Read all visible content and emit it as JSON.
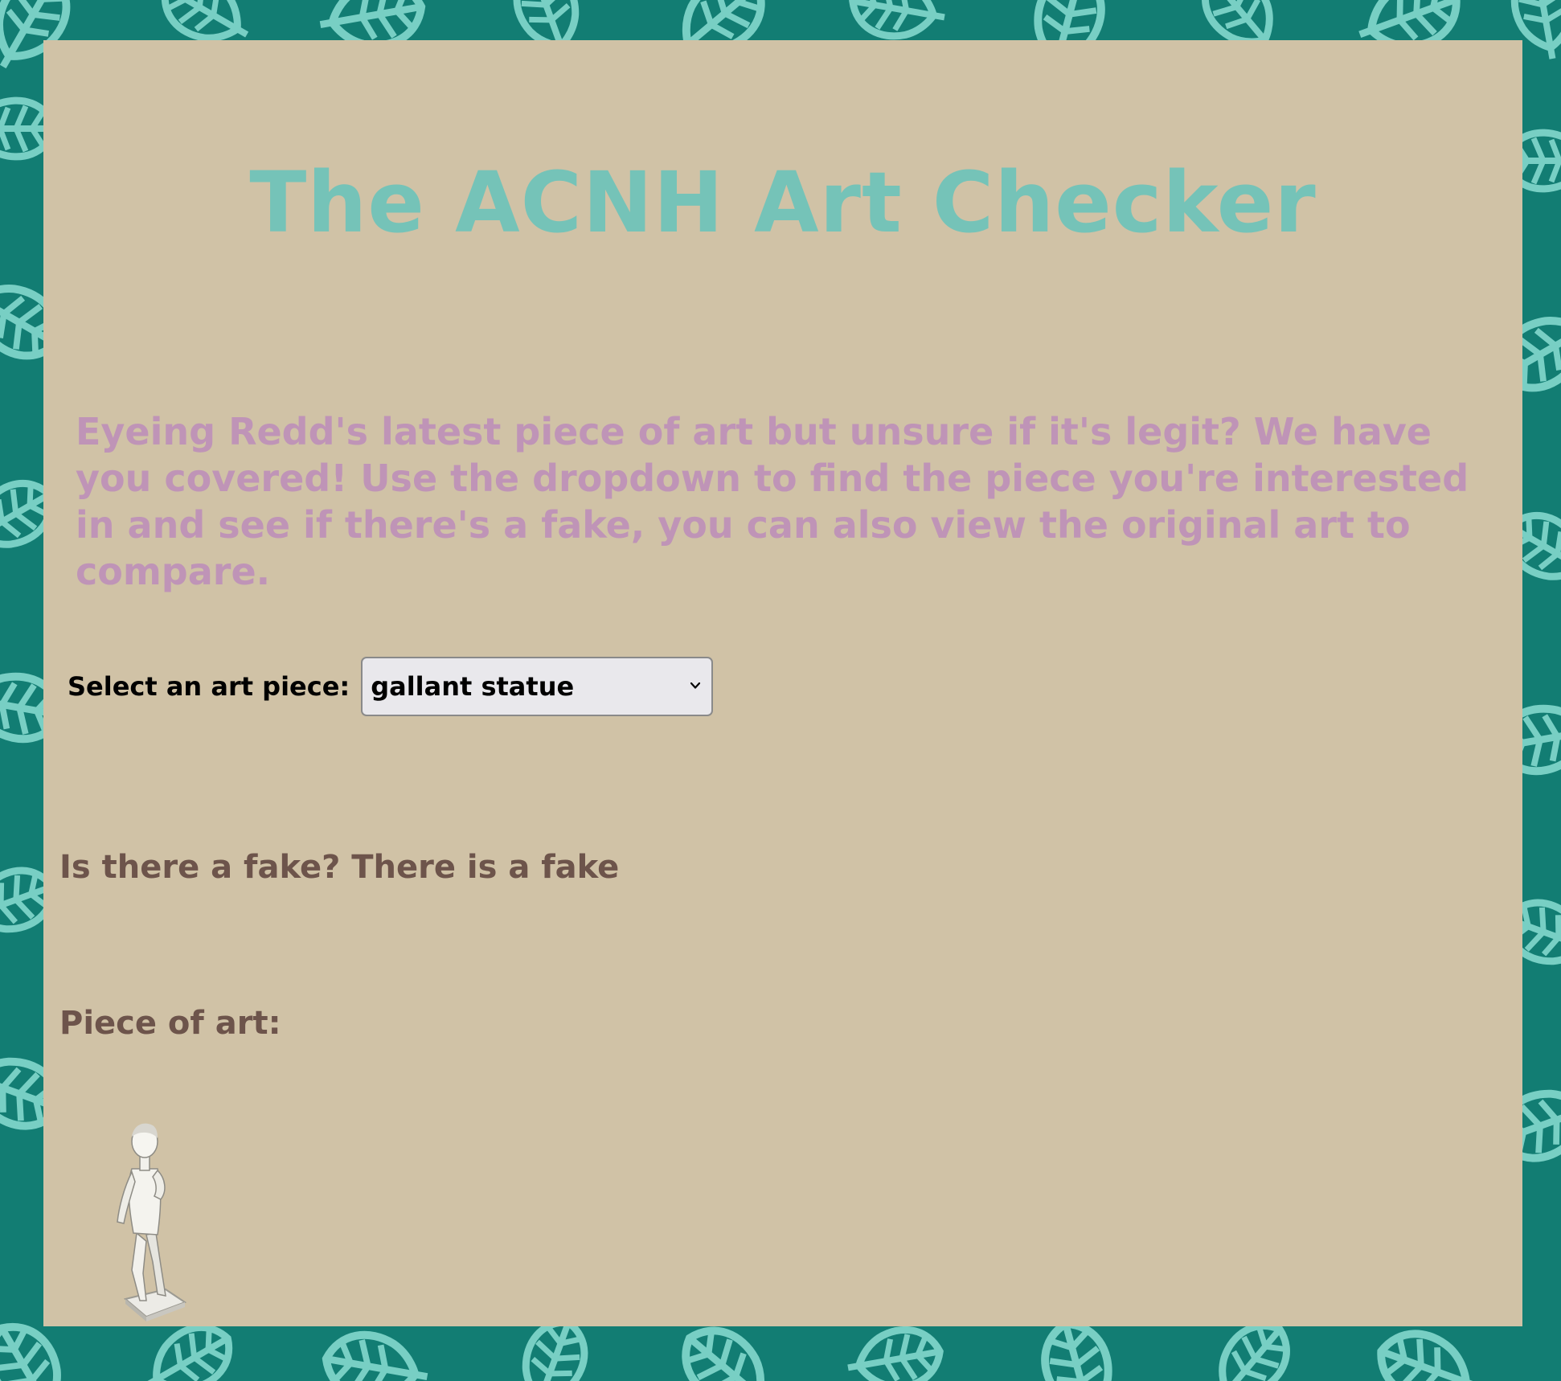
{
  "header": {
    "title": "The ACNH Art Checker"
  },
  "intro": {
    "text": "Eyeing Redd's latest piece of art but unsure if it's legit? We have you covered! Use the dropdown to find the piece you're interested in and see if there's a fake, you can also view the original art to compare."
  },
  "selector": {
    "label": "Select an art piece:",
    "selected_value": "gallant statue"
  },
  "result": {
    "fake_text": "Is there a fake? There is a fake"
  },
  "art": {
    "label": "Piece of art:",
    "image_icon": "statue-image"
  },
  "colors": {
    "background": "#127d73",
    "leaf_pattern": "#78cfc4",
    "panel": "#d0c2a6",
    "title": "#75c3b8",
    "intro": "#bf94b7",
    "result_text": "#6d544b"
  }
}
